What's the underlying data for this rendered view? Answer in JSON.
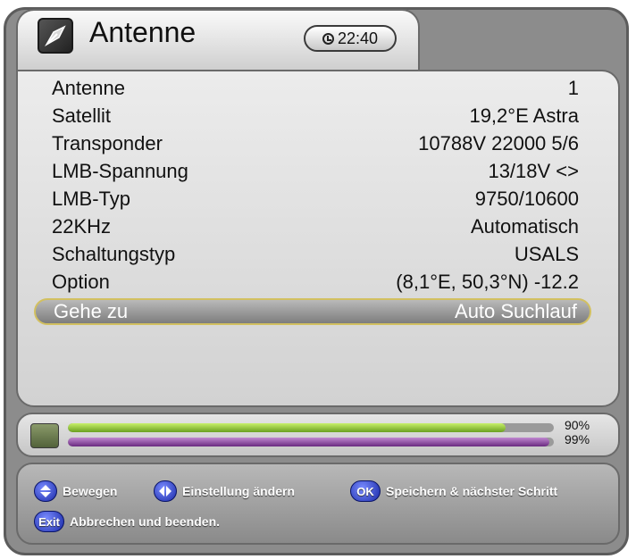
{
  "header": {
    "title": "Antenne",
    "clock": "22:40"
  },
  "settings": [
    {
      "label": "Antenne",
      "value": "1"
    },
    {
      "label": "Satellit",
      "value": "19,2°E Astra"
    },
    {
      "label": "Transponder",
      "value": "10788V 22000 5/6"
    },
    {
      "label": "LMB-Spannung",
      "value": "13/18V <>"
    },
    {
      "label": "LMB-Typ",
      "value": "9750/10600"
    },
    {
      "label": "22KHz",
      "value": "Automatisch"
    },
    {
      "label": "Schaltungstyp",
      "value": "USALS"
    },
    {
      "label": "Option",
      "value": "(8,1°E, 50,3°N) -12.2"
    },
    {
      "label": "Gehe zu",
      "value": "Auto Suchlauf",
      "selected": true
    }
  ],
  "signal": {
    "strength_percent": 90,
    "quality_percent": 99,
    "strength_label": "90%",
    "quality_label": "99%"
  },
  "help": {
    "move": "Bewegen",
    "change": "Einstellung ändern",
    "ok_key": "OK",
    "ok_text": "Speichern & nächster Schritt",
    "exit_key": "Exit",
    "exit_text": "Abbrechen und beenden."
  },
  "colors": {
    "strength_bar": "#9acd3a",
    "quality_bar": "#8a3aa0",
    "selection_border": "#d2c060",
    "help_buttons": "#2a3ac0"
  }
}
